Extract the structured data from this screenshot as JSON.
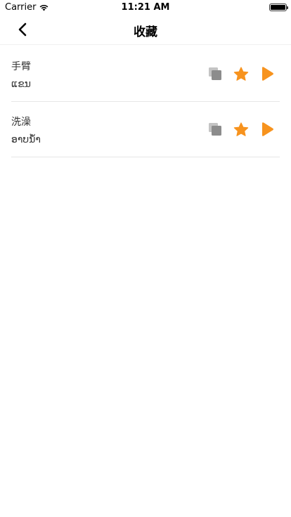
{
  "status_bar": {
    "carrier": "Carrier",
    "time": "11:21 AM"
  },
  "nav": {
    "title": "收藏",
    "back_icon": "chevron-left-icon"
  },
  "favorites": [
    {
      "source": "手臂",
      "translation": "ແຂນ"
    },
    {
      "source": "洗澡",
      "translation": "ອາບນ້ຳ"
    }
  ],
  "icons": {
    "copy": "copy-icon",
    "favorite": "star-icon",
    "play": "play-icon"
  },
  "colors": {
    "accent": "#f7931e",
    "copy_icon": "#8c8c8c",
    "divider": "#e6e6e6"
  }
}
